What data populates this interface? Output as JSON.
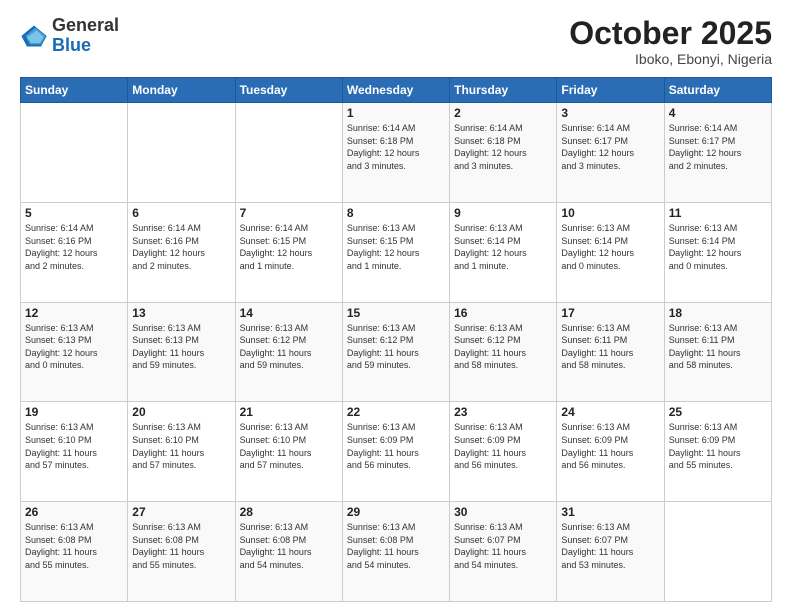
{
  "header": {
    "logo_general": "General",
    "logo_blue": "Blue",
    "month": "October 2025",
    "location": "Iboko, Ebonyi, Nigeria"
  },
  "days_of_week": [
    "Sunday",
    "Monday",
    "Tuesday",
    "Wednesday",
    "Thursday",
    "Friday",
    "Saturday"
  ],
  "weeks": [
    [
      {
        "day": "",
        "text": ""
      },
      {
        "day": "",
        "text": ""
      },
      {
        "day": "",
        "text": ""
      },
      {
        "day": "1",
        "text": "Sunrise: 6:14 AM\nSunset: 6:18 PM\nDaylight: 12 hours\nand 3 minutes."
      },
      {
        "day": "2",
        "text": "Sunrise: 6:14 AM\nSunset: 6:18 PM\nDaylight: 12 hours\nand 3 minutes."
      },
      {
        "day": "3",
        "text": "Sunrise: 6:14 AM\nSunset: 6:17 PM\nDaylight: 12 hours\nand 3 minutes."
      },
      {
        "day": "4",
        "text": "Sunrise: 6:14 AM\nSunset: 6:17 PM\nDaylight: 12 hours\nand 2 minutes."
      }
    ],
    [
      {
        "day": "5",
        "text": "Sunrise: 6:14 AM\nSunset: 6:16 PM\nDaylight: 12 hours\nand 2 minutes."
      },
      {
        "day": "6",
        "text": "Sunrise: 6:14 AM\nSunset: 6:16 PM\nDaylight: 12 hours\nand 2 minutes."
      },
      {
        "day": "7",
        "text": "Sunrise: 6:14 AM\nSunset: 6:15 PM\nDaylight: 12 hours\nand 1 minute."
      },
      {
        "day": "8",
        "text": "Sunrise: 6:13 AM\nSunset: 6:15 PM\nDaylight: 12 hours\nand 1 minute."
      },
      {
        "day": "9",
        "text": "Sunrise: 6:13 AM\nSunset: 6:14 PM\nDaylight: 12 hours\nand 1 minute."
      },
      {
        "day": "10",
        "text": "Sunrise: 6:13 AM\nSunset: 6:14 PM\nDaylight: 12 hours\nand 0 minutes."
      },
      {
        "day": "11",
        "text": "Sunrise: 6:13 AM\nSunset: 6:14 PM\nDaylight: 12 hours\nand 0 minutes."
      }
    ],
    [
      {
        "day": "12",
        "text": "Sunrise: 6:13 AM\nSunset: 6:13 PM\nDaylight: 12 hours\nand 0 minutes."
      },
      {
        "day": "13",
        "text": "Sunrise: 6:13 AM\nSunset: 6:13 PM\nDaylight: 11 hours\nand 59 minutes."
      },
      {
        "day": "14",
        "text": "Sunrise: 6:13 AM\nSunset: 6:12 PM\nDaylight: 11 hours\nand 59 minutes."
      },
      {
        "day": "15",
        "text": "Sunrise: 6:13 AM\nSunset: 6:12 PM\nDaylight: 11 hours\nand 59 minutes."
      },
      {
        "day": "16",
        "text": "Sunrise: 6:13 AM\nSunset: 6:12 PM\nDaylight: 11 hours\nand 58 minutes."
      },
      {
        "day": "17",
        "text": "Sunrise: 6:13 AM\nSunset: 6:11 PM\nDaylight: 11 hours\nand 58 minutes."
      },
      {
        "day": "18",
        "text": "Sunrise: 6:13 AM\nSunset: 6:11 PM\nDaylight: 11 hours\nand 58 minutes."
      }
    ],
    [
      {
        "day": "19",
        "text": "Sunrise: 6:13 AM\nSunset: 6:10 PM\nDaylight: 11 hours\nand 57 minutes."
      },
      {
        "day": "20",
        "text": "Sunrise: 6:13 AM\nSunset: 6:10 PM\nDaylight: 11 hours\nand 57 minutes."
      },
      {
        "day": "21",
        "text": "Sunrise: 6:13 AM\nSunset: 6:10 PM\nDaylight: 11 hours\nand 57 minutes."
      },
      {
        "day": "22",
        "text": "Sunrise: 6:13 AM\nSunset: 6:09 PM\nDaylight: 11 hours\nand 56 minutes."
      },
      {
        "day": "23",
        "text": "Sunrise: 6:13 AM\nSunset: 6:09 PM\nDaylight: 11 hours\nand 56 minutes."
      },
      {
        "day": "24",
        "text": "Sunrise: 6:13 AM\nSunset: 6:09 PM\nDaylight: 11 hours\nand 56 minutes."
      },
      {
        "day": "25",
        "text": "Sunrise: 6:13 AM\nSunset: 6:09 PM\nDaylight: 11 hours\nand 55 minutes."
      }
    ],
    [
      {
        "day": "26",
        "text": "Sunrise: 6:13 AM\nSunset: 6:08 PM\nDaylight: 11 hours\nand 55 minutes."
      },
      {
        "day": "27",
        "text": "Sunrise: 6:13 AM\nSunset: 6:08 PM\nDaylight: 11 hours\nand 55 minutes."
      },
      {
        "day": "28",
        "text": "Sunrise: 6:13 AM\nSunset: 6:08 PM\nDaylight: 11 hours\nand 54 minutes."
      },
      {
        "day": "29",
        "text": "Sunrise: 6:13 AM\nSunset: 6:08 PM\nDaylight: 11 hours\nand 54 minutes."
      },
      {
        "day": "30",
        "text": "Sunrise: 6:13 AM\nSunset: 6:07 PM\nDaylight: 11 hours\nand 54 minutes."
      },
      {
        "day": "31",
        "text": "Sunrise: 6:13 AM\nSunset: 6:07 PM\nDaylight: 11 hours\nand 53 minutes."
      },
      {
        "day": "",
        "text": ""
      }
    ]
  ]
}
